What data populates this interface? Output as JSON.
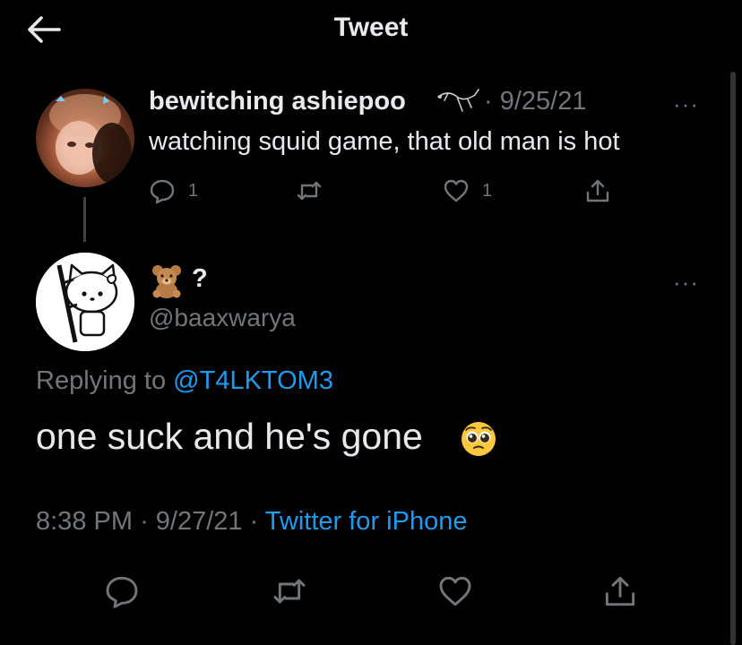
{
  "header": {
    "title": "Tweet",
    "back_icon": "arrow-left-icon"
  },
  "parent_tweet": {
    "display_name": "bewitching ashiepoo",
    "date": "· 9/25/21",
    "more": "···",
    "text": "watching squid game, that old man is hot",
    "actions": {
      "reply_count": "1",
      "retweet_count": "",
      "like_count": "1"
    }
  },
  "main_tweet": {
    "display_name": "?",
    "name_emoji": "teddy-bear-emoji",
    "handle": "@baaxwarya",
    "more": "···",
    "replying_prefix": "Replying to ",
    "replying_to": "@T4LKTOM3",
    "text": "one suck and he's gone",
    "text_emoji": "pleading-face-emoji",
    "time": "8:38 PM",
    "date": "· 9/27/21 ·",
    "source": "Twitter for iPhone"
  },
  "colors": {
    "background": "#000000",
    "text": "#e7e9ea",
    "muted": "#71767b",
    "link": "#1d9bf0"
  }
}
